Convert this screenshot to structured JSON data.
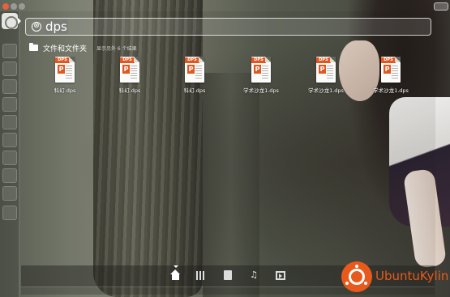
{
  "search": {
    "query": "dps",
    "clear_icon": "⊗"
  },
  "category": {
    "title": "文件和文件夹",
    "more_results": "显示另外 6 个结果"
  },
  "results": [
    {
      "label": "科幻.dps",
      "badge": "DPS",
      "mark": "P"
    },
    {
      "label": "科幻.dps",
      "badge": "DPS",
      "mark": "P"
    },
    {
      "label": "科幻.dps",
      "badge": "DPS",
      "mark": "P"
    },
    {
      "label": "学术沙龙1.dps",
      "badge": "DPS",
      "mark": "P"
    },
    {
      "label": "学术沙龙1.dps",
      "badge": "DPS",
      "mark": "P"
    },
    {
      "label": "学术沙龙1.dps",
      "badge": "DPS",
      "mark": "P"
    }
  ],
  "lenses": [
    "home-lens",
    "applications-lens",
    "files-lens",
    "music-lens",
    "video-lens"
  ],
  "logo": {
    "text": "UbuntuKylin",
    "color": "#e85a1c"
  },
  "colors": {
    "accent": "#e85a1c",
    "doc_badge": "#e2571f"
  }
}
